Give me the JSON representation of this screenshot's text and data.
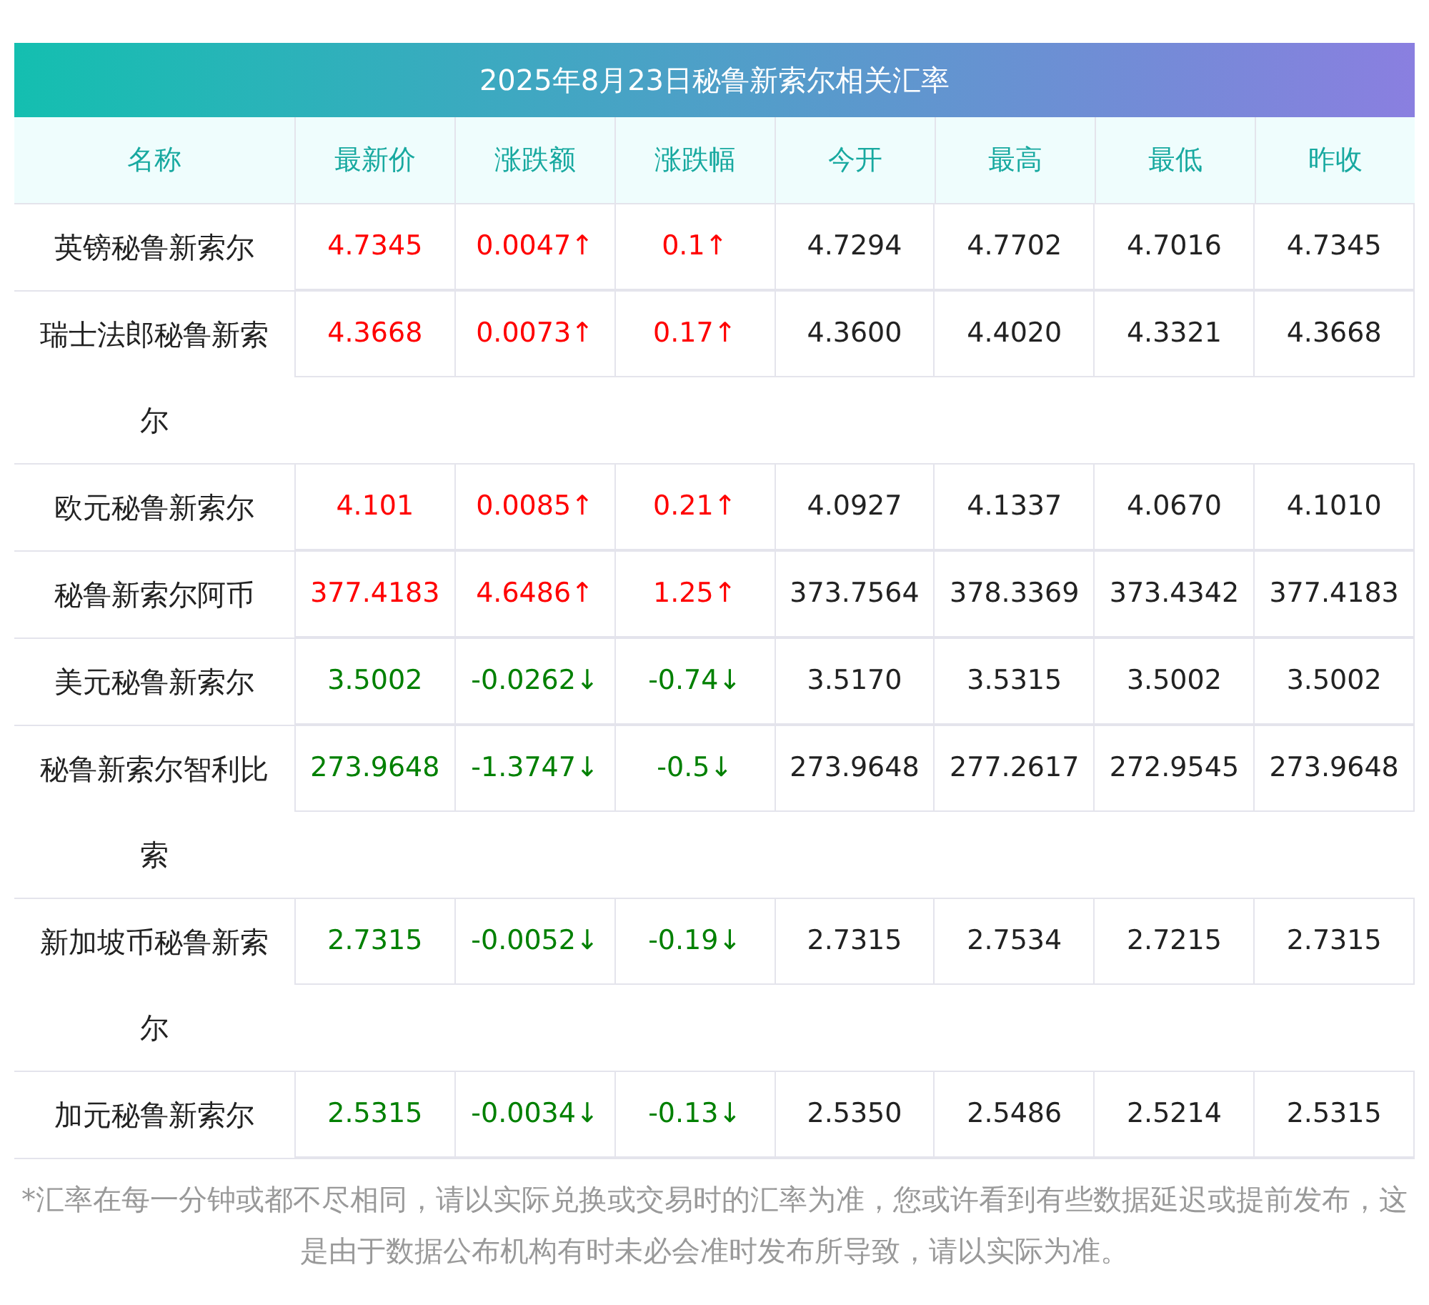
{
  "title": "2025年8月23日秘鲁新索尔相关汇率",
  "columns": [
    "名称",
    "最新价",
    "涨跌额",
    "涨跌幅",
    "今开",
    "最高",
    "最低",
    "昨收"
  ],
  "rows": [
    {
      "name": "英镑秘鲁新索尔",
      "rising": true,
      "cells": [
        "4.7345",
        "0.0047↑",
        "0.1↑",
        "4.7294",
        "4.7702",
        "4.7016",
        "4.7345"
      ]
    },
    {
      "name": "瑞士法郎秘鲁新索尔",
      "rising": true,
      "cells": [
        "4.3668",
        "0.0073↑",
        "0.17↑",
        "4.3600",
        "4.4020",
        "4.3321",
        "4.3668"
      ]
    },
    {
      "name": "欧元秘鲁新索尔",
      "rising": true,
      "cells": [
        "4.101",
        "0.0085↑",
        "0.21↑",
        "4.0927",
        "4.1337",
        "4.0670",
        "4.1010"
      ]
    },
    {
      "name": "秘鲁新索尔阿币",
      "rising": true,
      "cells": [
        "377.4183",
        "4.6486↑",
        "1.25↑",
        "373.7564",
        "378.3369",
        "373.4342",
        "377.4183"
      ]
    },
    {
      "name": "美元秘鲁新索尔",
      "rising": false,
      "cells": [
        "3.5002",
        "-0.0262↓",
        "-0.74↓",
        "3.5170",
        "3.5315",
        "3.5002",
        "3.5002"
      ]
    },
    {
      "name": "秘鲁新索尔智利比索",
      "rising": false,
      "cells": [
        "273.9648",
        "-1.3747↓",
        "-0.5↓",
        "273.9648",
        "277.2617",
        "272.9545",
        "273.9648"
      ]
    },
    {
      "name": "新加坡币秘鲁新索尔",
      "rising": false,
      "cells": [
        "2.7315",
        "-0.0052↓",
        "-0.19↓",
        "2.7315",
        "2.7534",
        "2.7215",
        "2.7315"
      ]
    },
    {
      "name": "加元秘鲁新索尔",
      "rising": false,
      "cells": [
        "2.5315",
        "-0.0034↓",
        "-0.13↓",
        "2.5350",
        "2.5486",
        "2.5214",
        "2.5315"
      ]
    }
  ],
  "footnote": "*汇率在每一分钟或都不尽相同，请以实际兑换或交易时的汇率为准，您或许看到有些数据延迟或提前发布，这是由于数据公布机构有时未必会准时发布所导致，请以实际为准。"
}
